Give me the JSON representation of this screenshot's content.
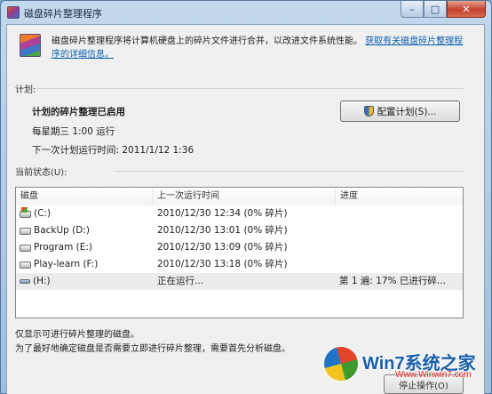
{
  "window": {
    "title": "磁盘碎片整理程序"
  },
  "intro": {
    "text": "磁盘碎片整理程序将计算机硬盘上的碎片文件进行合并，以改进文件系统性能。",
    "link_line1": "获取有关磁盘碎片整理程",
    "link_line2": "序的详细信息。"
  },
  "schedule": {
    "section_label": "计划:",
    "title": "计划的碎片整理已启用",
    "frequency": "每星期三  1:00 运行",
    "next_run": "下一次计划运行时间: 2011/1/12 1:36",
    "configure_button": "配置计划(S)..."
  },
  "status": {
    "section_label": "当前状态(U):",
    "columns": [
      "磁盘",
      "上一次运行时间",
      "进度"
    ],
    "rows": [
      {
        "disk": "(C:)",
        "last_run": "2010/12/30 12:34 (0% 碎片)",
        "progress": "",
        "icon": "system-drive-icon"
      },
      {
        "disk": "BackUp (D:)",
        "last_run": "2010/12/30 13:01 (0% 碎片)",
        "progress": "",
        "icon": "hard-drive-icon"
      },
      {
        "disk": "Program (E:)",
        "last_run": "2010/12/30 13:09 (0% 碎片)",
        "progress": "",
        "icon": "hard-drive-icon"
      },
      {
        "disk": "Play-learn (F:)",
        "last_run": "2010/12/30 13:18 (0% 碎片)",
        "progress": "",
        "icon": "hard-drive-icon"
      },
      {
        "disk": "(H:)",
        "last_run": "正在运行...",
        "progress": "第 1 遍: 17% 已进行碎...",
        "icon": "usb-drive-icon"
      }
    ]
  },
  "footer": {
    "note1": "仅显示可进行碎片整理的磁盘。",
    "note2": "为了最好地确定磁盘是否需要立即进行碎片整理，需要首先分析磁盘。",
    "stop_button": "停止操作(O)"
  },
  "watermark": {
    "text": "Win7系统之家",
    "url": "Www.Winwin7.com"
  }
}
